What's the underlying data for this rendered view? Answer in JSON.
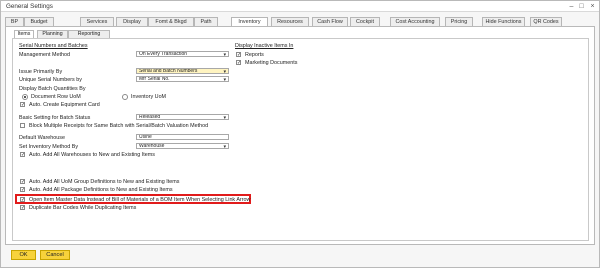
{
  "window": {
    "title": "General Settings",
    "minimize": "–",
    "maximize": "□",
    "close": "×"
  },
  "tabs": [
    "BP",
    "Budget",
    "Services",
    "Display",
    "Fomt & Bkgd",
    "Path",
    "Inventory",
    "Resources",
    "Cash Flow",
    "Cockpit",
    "Cost Accounting",
    "Pricing",
    "Hide Functions",
    "QR Codes"
  ],
  "subtabs": [
    "Items",
    "Planning",
    "Reporting"
  ],
  "left": {
    "serial_header": "Serial Numbers and Batches",
    "management_label": "Management Method",
    "management_value": "On Every Transaction",
    "issue_label": "Issue Primarily By",
    "issue_value": "Serial and Batch Numbers",
    "unique_label": "Unique Serial Numbers by",
    "unique_value": "Mfr Serial No.",
    "display_batch": "Display Batch Quantities By",
    "radio1": "Document Row UoM",
    "radio2": "Inventory UoM",
    "auto_create": "Auto. Create Equipment Card",
    "basic_label": "Basic Setting for Batch Status",
    "basic_value": "Released",
    "block_multiple": "Block Multiple Receipts for Same Batch with Serial/Batch Valuation Method",
    "default_wh_label": "Default Warehouse",
    "default_wh_value": "Usine",
    "set_inv_label": "Set Inventory Method By",
    "set_inv_value": "Warehouse",
    "auto_add_wh": "Auto. Add All Warehouses to New and Existing Items",
    "auto_add_uom": "Auto. Add All UoM Group Definitions to New and Existing Items",
    "auto_add_pkg": "Auto. Add All Package Definitions to New and Existing Items",
    "open_item": "Open Item Master Data Instead of Bill of Materials of a BOM Item When Selecting Link Arrow",
    "duplicate_bar": "Duplicate Bar Codes While Duplicating Items"
  },
  "right": {
    "header": "Display Inactive Items In",
    "reports": "Reports",
    "marketing": "Marketing Documents"
  },
  "check_mark": "✓",
  "dropdown_arrow": "▼",
  "buttons": {
    "ok": "OK",
    "cancel": "Cancel"
  }
}
